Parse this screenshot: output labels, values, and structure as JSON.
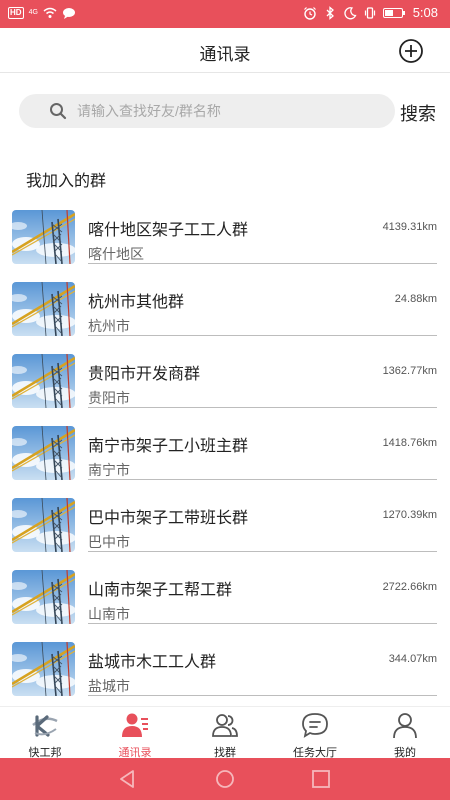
{
  "status_bar": {
    "hd": "HD",
    "signal": "4G",
    "time": "5:08",
    "battery_level": 0.55
  },
  "header": {
    "title": "通讯录"
  },
  "search": {
    "placeholder": "请输入查找好友/群名称",
    "button_label": "搜索"
  },
  "section": {
    "title": "我加入的群"
  },
  "groups": [
    {
      "name": "喀什地区架子工工人群",
      "city": "喀什地区",
      "distance": "4139.31km"
    },
    {
      "name": "杭州市其他群",
      "city": "杭州市",
      "distance": "24.88km"
    },
    {
      "name": "贵阳市开发商群",
      "city": "贵阳市",
      "distance": "1362.77km"
    },
    {
      "name": "南宁市架子工小班主群",
      "city": "南宁市",
      "distance": "1418.76km"
    },
    {
      "name": "巴中市架子工带班长群",
      "city": "巴中市",
      "distance": "1270.39km"
    },
    {
      "name": "山南市架子工帮工群",
      "city": "山南市",
      "distance": "2722.66km"
    },
    {
      "name": "盐城市木工工人群",
      "city": "盐城市",
      "distance": "344.07km"
    }
  ],
  "tabs": [
    {
      "label": "快工邦",
      "icon": "app-logo-icon"
    },
    {
      "label": "通讯录",
      "icon": "contacts-icon"
    },
    {
      "label": "找群",
      "icon": "find-group-icon"
    },
    {
      "label": "任务大厅",
      "icon": "task-hall-icon"
    },
    {
      "label": "我的",
      "icon": "profile-icon"
    }
  ],
  "active_tab": 1,
  "colors": {
    "accent": "#e8505b",
    "text": "#222222",
    "secondary_text": "#666666",
    "search_bg": "#eeeeee"
  }
}
